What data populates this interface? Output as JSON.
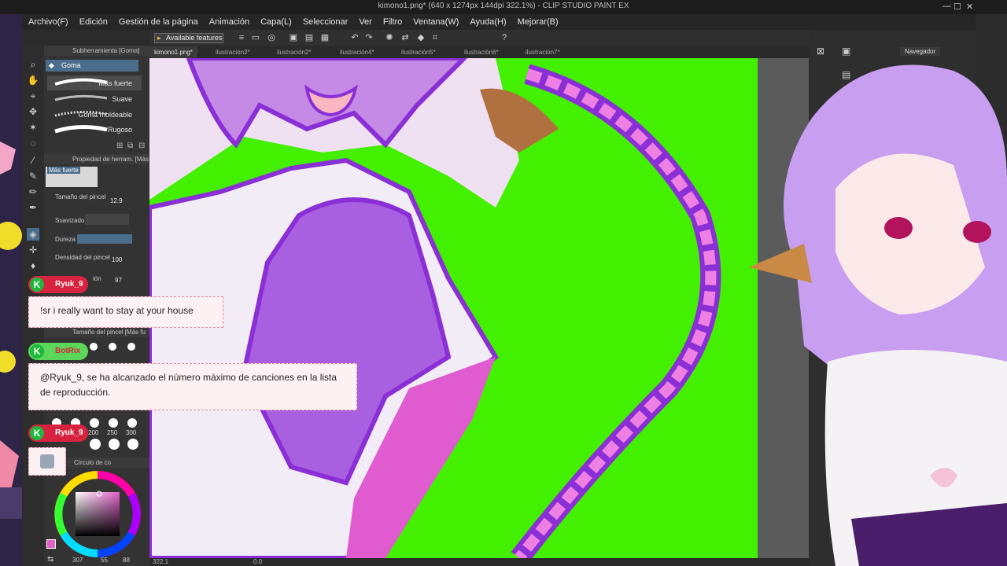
{
  "window": {
    "title": "kimono1.png* (640 x 1274px 144dpi 322.1%)  - CLIP STUDIO PAINT EX",
    "minimize": "—",
    "maximize": "☐",
    "close": "✕"
  },
  "menu": [
    "Archivo(F)",
    "Edición",
    "Gestión de la página",
    "Animación",
    "Capa(L)",
    "Seleccionar",
    "Ver",
    "Filtro",
    "Ventana(W)",
    "Ayuda(H)",
    "Mejorar(B)"
  ],
  "toolbar": {
    "available_features": "Available features"
  },
  "tabs": [
    "kimono1.png*",
    "ilustración3*",
    "ilustración2*",
    "ilustración4*",
    "ilustración5*",
    "ilustración6*",
    "ilustración7*"
  ],
  "subtool": {
    "header": "Subherramienta [Goma]",
    "selected": "Goma",
    "brushes": [
      "Más fuerte",
      "Suave",
      "Goma moldeable",
      "Rugoso"
    ]
  },
  "tool_property": {
    "header": "Propiedad de herram. [Más",
    "preview": "Más fuerte",
    "brush_size_label": "Tamaño del pincel",
    "brush_size_value": "12.9",
    "smoothing_label": "Suavizado",
    "hardness_label": "Dureza",
    "density_label": "Densidad del pincel",
    "density_value": "100",
    "hidden_label": "ión",
    "hidden_value": "97"
  },
  "brush_size_panel": {
    "header": "Tamaño del pincel [Más fu",
    "sizes": [
      "200",
      "250",
      "300"
    ]
  },
  "color_panel": {
    "header": "Círculo de co",
    "current_color": "#e060c8",
    "readout": "307",
    "readout2": "55",
    "readout3": "88"
  },
  "status": {
    "zoom": "322.1",
    "angle": "0.0"
  },
  "navigator": {
    "label": "Navegador"
  },
  "chat": [
    {
      "user": "Ryuk_9",
      "message": "!sr i really want to stay at your house"
    },
    {
      "user": "BotRix",
      "message": "@Ryuk_9, se ha alcanzado el número máximo de canciones en la lista de reproducción."
    },
    {
      "user": "Ryuk_9",
      "message": ""
    }
  ],
  "colors": {
    "canvas_green": "#43f000",
    "purple_dark": "#8a2fd6",
    "purple_mid": "#a85fe0",
    "pink": "#ee7fe3",
    "chat_red": "#d7233f",
    "kick_green": "#1db83c",
    "selection_blue": "#4a6d8c"
  }
}
